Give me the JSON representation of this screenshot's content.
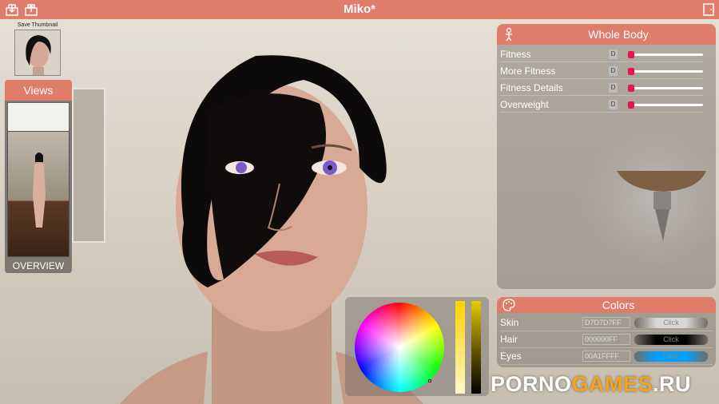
{
  "window": {
    "title": "Miko*"
  },
  "thumbnail": {
    "label": "Save Thumbnail"
  },
  "views": {
    "title": "Views",
    "footer": "OVERVIEW"
  },
  "body_panel": {
    "title": "Whole Body",
    "sliders": [
      {
        "label": "Fitness",
        "d": "D",
        "value": 0
      },
      {
        "label": "More Fitness",
        "d": "D",
        "value": 0
      },
      {
        "label": "Fitness Details",
        "d": "D",
        "value": 0
      },
      {
        "label": "Overweight",
        "d": "D",
        "value": 0
      }
    ]
  },
  "colors_panel": {
    "title": "Colors",
    "rows": [
      {
        "label": "Skin",
        "hex": "D7D7D7FF",
        "button": "Click",
        "color": "#d7d7d7"
      },
      {
        "label": "Hair",
        "hex": "000000FF",
        "button": "Click",
        "color": "#000000"
      },
      {
        "label": "Eyes",
        "hex": "00A1FFFF",
        "button": "Click",
        "color": "#00a1ff"
      }
    ]
  },
  "watermark": {
    "part1": "PORNO",
    "part2": "GAMES",
    "part3": ".RU"
  },
  "colors": {
    "accent": "#e07c6a",
    "slider_knob": "#e8174a"
  }
}
